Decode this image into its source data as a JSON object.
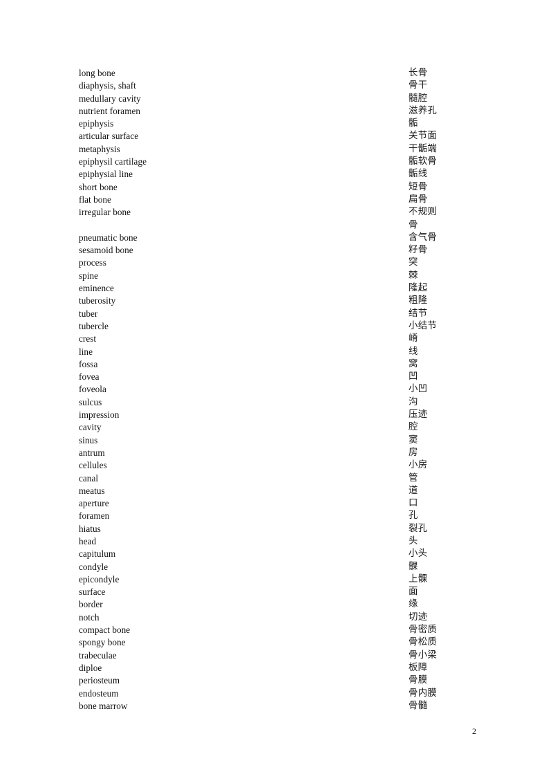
{
  "document": {
    "page_number": "2",
    "background_color": "#ffffff",
    "text_color": "#111111"
  },
  "glossary": {
    "rows": [
      {
        "en": "long bone",
        "zh": "长骨"
      },
      {
        "en": "diaphysis, shaft",
        "zh": "骨干"
      },
      {
        "en": "medullary cavity",
        "zh": "髓腔"
      },
      {
        "en": "nutrient foramen",
        "zh": "滋养孔"
      },
      {
        "en": "epiphysis",
        "zh": "骺"
      },
      {
        "en": "articular surface",
        "zh": "关节面"
      },
      {
        "en": "metaphysis",
        "zh": "干骺端"
      },
      {
        "en": "epiphysil cartilage",
        "zh": "骺软骨"
      },
      {
        "en": "epiphysial line",
        "zh": "骺线"
      },
      {
        "en": "short bone",
        "zh": "短骨"
      },
      {
        "en": "flat bone",
        "zh": "扁骨"
      },
      {
        "en": "irregular bone",
        "zh": "不规则"
      },
      {
        "en": "",
        "zh": "骨"
      },
      {
        "en": "pneumatic bone",
        "zh": "含气骨"
      },
      {
        "en": "sesamoid bone",
        "zh": "籽骨"
      },
      {
        "en": "process",
        "zh": "突"
      },
      {
        "en": "spine",
        "zh": "棘"
      },
      {
        "en": "eminence",
        "zh": "隆起"
      },
      {
        "en": "tuberosity",
        "zh": "粗隆"
      },
      {
        "en": "tuber",
        "zh": "结节"
      },
      {
        "en": "tubercle",
        "zh": "小结节"
      },
      {
        "en": "crest",
        "zh": "嵴"
      },
      {
        "en": "line",
        "zh": "线"
      },
      {
        "en": "fossa",
        "zh": "窝"
      },
      {
        "en": "fovea",
        "zh": "凹"
      },
      {
        "en": "foveola",
        "zh": "小凹"
      },
      {
        "en": "sulcus",
        "zh": "沟"
      },
      {
        "en": "impression",
        "zh": "压迹"
      },
      {
        "en": "cavity",
        "zh": "腔"
      },
      {
        "en": "sinus",
        "zh": "窦"
      },
      {
        "en": "antrum",
        "zh": "房"
      },
      {
        "en": "cellules",
        "zh": "小房"
      },
      {
        "en": "canal",
        "zh": "管"
      },
      {
        "en": "meatus",
        "zh": "道"
      },
      {
        "en": "aperture",
        "zh": "口"
      },
      {
        "en": "foramen",
        "zh": "孔"
      },
      {
        "en": "hiatus",
        "zh": "裂孔"
      },
      {
        "en": "head",
        "zh": "头"
      },
      {
        "en": "capitulum",
        "zh": "小头"
      },
      {
        "en": "condyle",
        "zh": "髁"
      },
      {
        "en": "epicondyle",
        "zh": "上髁"
      },
      {
        "en": "surface",
        "zh": "面"
      },
      {
        "en": "border",
        "zh": "缘"
      },
      {
        "en": "notch",
        "zh": "切迹"
      },
      {
        "en": "compact bone",
        "zh": "骨密质"
      },
      {
        "en": "spongy bone",
        "zh": "骨松质"
      },
      {
        "en": "trabeculae",
        "zh": "骨小梁"
      },
      {
        "en": "diploe",
        "zh": "板障"
      },
      {
        "en": "periosteum",
        "zh": "骨膜"
      },
      {
        "en": "endosteum",
        "zh": "骨内膜"
      },
      {
        "en": "bone marrow",
        "zh": "骨髓"
      }
    ]
  }
}
